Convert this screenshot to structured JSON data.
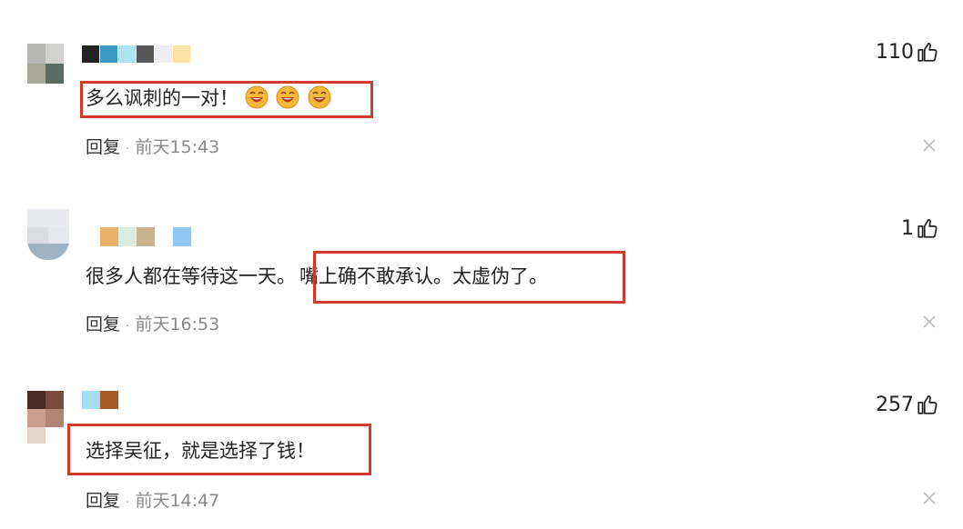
{
  "comments": [
    {
      "text": "多么讽刺的一对！",
      "emoji_count": 3,
      "emoji_name": "laughing-face-icon",
      "reply_label": "回复",
      "separator": "·",
      "time": "前天15:43",
      "likes": "110",
      "username_colors": [
        "#222222",
        "#3b9ac4",
        "#aee3f2",
        "#555555",
        "#eeeef2",
        "#fde2a8"
      ],
      "avatar_colors": [
        "#b7b8b4",
        "#d2d3d0",
        "#a9aa97",
        "#5a6b62"
      ]
    },
    {
      "text_a": "很多人都在等待这一天。",
      "text_b": "嘴上确不敢承认。太虚伪了。",
      "reply_label": "回复",
      "separator": "·",
      "time": "前天16:53",
      "likes": "1",
      "username_colors": [
        "#e9b06a",
        "#d8ece4",
        "#c9b48e",
        "#8fc8f2"
      ],
      "avatar_colors": [
        "#dbdde4",
        "#e8eaf0",
        "#9fb2c4",
        "#e4e8ee"
      ]
    },
    {
      "text": "选择吴征，就是选择了钱！",
      "reply_label": "回复",
      "separator": "·",
      "time": "前天14:47",
      "likes": "257",
      "username_colors": [
        "#a6def0",
        "#a95d24"
      ],
      "avatar_colors": [
        "#4a2a22",
        "#7a4a3c",
        "#b08574",
        "#e6d4cc"
      ]
    }
  ],
  "colors": {
    "highlight": "#d23a2a",
    "text": "#222222",
    "time": "#8a8a8a"
  }
}
